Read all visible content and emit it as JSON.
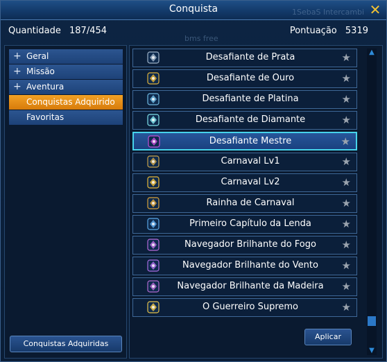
{
  "window": {
    "title": "Conquista",
    "close_glyph": "✕"
  },
  "watermarks": {
    "top": "1SebaS Intercambi",
    "mid": "bms free"
  },
  "stats": {
    "quantity_label": "Quantidade",
    "quantity_value": "187/454",
    "score_label": "Pontuação",
    "score_value": "5319"
  },
  "categories": [
    {
      "label": "Geral",
      "expandable": true,
      "active": false
    },
    {
      "label": "Missão",
      "expandable": true,
      "active": false
    },
    {
      "label": "Aventura",
      "expandable": true,
      "active": false
    },
    {
      "label": "Conquistas Adquirido",
      "expandable": false,
      "active": true
    },
    {
      "label": "Favoritas",
      "expandable": false,
      "active": false
    }
  ],
  "left_button_label": "Conquistas Adquiridas",
  "achievements": [
    {
      "name": "Desafiante de Prata",
      "icon": "silver-challenger-icon",
      "color": "#9fb3c8",
      "selected": false
    },
    {
      "name": "Desafiante de Ouro",
      "icon": "gold-challenger-icon",
      "color": "#e0b23a",
      "selected": false
    },
    {
      "name": "Desafiante de Platina",
      "icon": "platinum-challenger-icon",
      "color": "#6fb8e0",
      "selected": false
    },
    {
      "name": "Desafiante de Diamante",
      "icon": "diamond-challenger-icon",
      "color": "#7fe0e8",
      "selected": false
    },
    {
      "name": "Desafiante Mestre",
      "icon": "master-challenger-icon",
      "color": "#c34fd6",
      "selected": true
    },
    {
      "name": "Carnaval Lv1",
      "icon": "carnival-crown-icon",
      "color": "#c9a24a",
      "selected": false
    },
    {
      "name": "Carnaval Lv2",
      "icon": "carnival-crown-icon",
      "color": "#e8b838",
      "selected": false
    },
    {
      "name": "Rainha de Carnaval",
      "icon": "carnival-queen-icon",
      "color": "#d9a23a",
      "selected": false
    },
    {
      "name": "Primeiro Capítulo da Lenda",
      "icon": "legend-shield-icon",
      "color": "#5aa6e6",
      "selected": false
    },
    {
      "name": "Navegador Brilhante do Fogo",
      "icon": "fire-navigator-icon",
      "color": "#b46ad8",
      "selected": false
    },
    {
      "name": "Navegador Brilhante do Vento",
      "icon": "wind-navigator-icon",
      "color": "#a86ce0",
      "selected": false
    },
    {
      "name": "Navegador Brilhante da Madeira",
      "icon": "wood-navigator-icon",
      "color": "#b26ad0",
      "selected": false
    },
    {
      "name": "O Guerreiro Supremo",
      "icon": "supreme-warrior-icon",
      "color": "#e6c24a",
      "selected": false
    }
  ],
  "apply_button_label": "Aplicar",
  "favorite_star_glyph": "★",
  "scroll": {
    "up": "▲",
    "down": "▼"
  },
  "colors": {
    "accent_orange": "#e88e16",
    "selection_border": "#47d3ea",
    "title_bar": "#1f4f86"
  }
}
